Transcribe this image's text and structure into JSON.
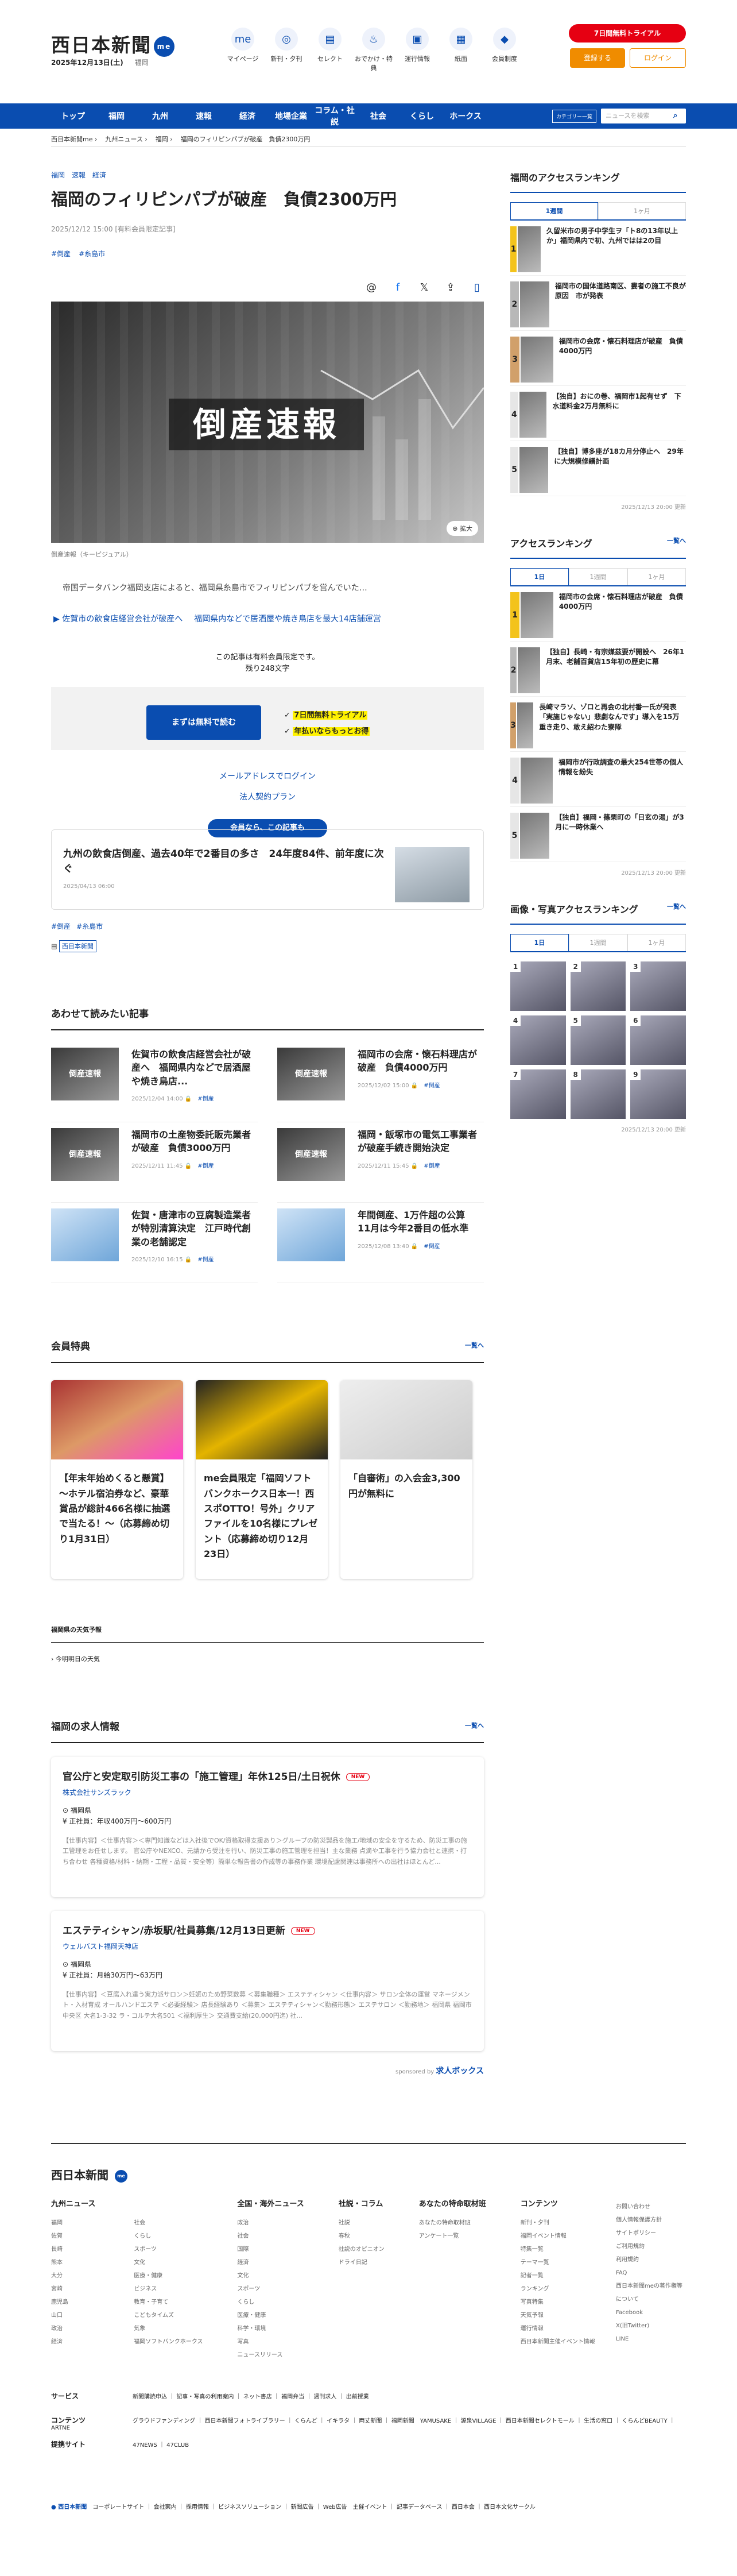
{
  "header": {
    "logo": "西日本新聞",
    "logo_badge": "me",
    "date": "2025年12月13日(土)",
    "region": "福岡",
    "icons": [
      {
        "label": "マイページ",
        "icon": "me"
      },
      {
        "label": "新刊・夕刊",
        "icon": "◎"
      },
      {
        "label": "セレクト",
        "icon": "▤"
      },
      {
        "label": "おでかけ・特典",
        "icon": "♨"
      },
      {
        "label": "運行情報",
        "icon": "▣"
      },
      {
        "label": "紙面",
        "icon": "▦"
      },
      {
        "label": "会員制度",
        "icon": "◆"
      }
    ],
    "trial": "7日間無料トライアル",
    "register": "登録する",
    "login": "ログイン"
  },
  "gnav": {
    "items": [
      "トップ",
      "福岡",
      "九州",
      "速報",
      "経済",
      "地場企業",
      "コラム・社説",
      "社会",
      "くらし",
      "ホークス"
    ],
    "category": "カテゴリー一覧",
    "search_placeholder": "ニュースを検索"
  },
  "breadcrumb": [
    "西日本新聞me",
    "九州ニュース",
    "福岡",
    "福岡のフィリピンパブが破産　負債2300万円"
  ],
  "article": {
    "tags": [
      "福岡",
      "速報",
      "経済"
    ],
    "title": "福岡のフィリピンパブが破産　負債2300万円",
    "published": "2025/12/12 15:00 [有料会員限定記事]",
    "hashtags": [
      "#倒産",
      "#糸島市"
    ],
    "hero_text": "倒産速報",
    "hero_caption": "倒産速報（キーピジュアル）",
    "hero_badge": "拡大",
    "lead": "帝国データバンク福岡支店によると、福岡県糸島市でフィリピンパブを営んでいた…",
    "related": [
      "佐賀市の飲食店経営会社が破産へ",
      "福岡県内などで居酒屋や焼き鳥店を最大14店舗運営"
    ],
    "paywall_text": "この記事は有料会員限定です。",
    "paywall_remaining": "残り248文字",
    "trial_button": "まずは無料で読む",
    "trial_points": [
      "7日間無料トライアル",
      "年払いならもっとお得"
    ],
    "email_login": "メールアドレスでログイン",
    "corporate": "法人契約プラン",
    "member_label": "会員なら、この記事も",
    "member_card": {
      "title": "九州の飲食店倒産、過去40年で2番目の多さ　24年度84件、前年度に次ぐ",
      "date": "2025/04/13 06:00"
    },
    "bottom_tags": [
      "#倒産",
      "#糸島市"
    ],
    "source": "西日本新聞"
  },
  "recommend": {
    "heading": "あわせて読みたい記事",
    "items": [
      {
        "title": "佐賀市の飲食店経営会社が破産へ　福岡県内などで居酒屋や焼き鳥店...",
        "date": "2025/12/04 14:00",
        "tag": "#倒産"
      },
      {
        "title": "福岡市の会席・懐石料理店が破産　負債4000万円",
        "date": "2025/12/02 15:00",
        "tag": "#倒産"
      },
      {
        "title": "福岡市の土産物委託販売業者が破産　負債3000万円",
        "date": "2025/12/11 11:45",
        "tag": "#倒産"
      },
      {
        "title": "福岡・飯塚市の電気工事業者が破産手続き開始決定",
        "date": "2025/12/11 15:45",
        "tag": "#倒産"
      },
      {
        "title": "佐賀・唐津市の豆腐製造業者が特別清算決定　江戸時代創業の老舗認定",
        "date": "2025/12/10 16:15",
        "tag": "#倒産"
      },
      {
        "title": "年間倒産、1万件超の公算　11月は今年2番目の低水準",
        "date": "2025/12/08 13:40",
        "tag": "#倒産"
      }
    ]
  },
  "benefits": {
    "heading": "会員特典",
    "more": "一覧へ",
    "items": [
      "【年末年始めくると懸賞】～ホテル宿泊券など、豪華賞品が総計466名様に抽選で当たる！～（応募締め切り1月31日）",
      "me会員限定「福岡ソフトバンクホークス日本一！西スポOTTO！号外」クリアファイルを10名様にプレゼント（応募締め切り12月23日）",
      "「自審術」の入会金3,300円が無料に"
    ]
  },
  "weather": {
    "heading": "福岡県の天気予報",
    "sub": "今明明日の天気"
  },
  "jobs": {
    "heading": "福岡の求人情報",
    "more": "一覧へ",
    "items": [
      {
        "title": "官公庁と安定取引防災工事の「施工管理」年休125日/土日祝休",
        "badge": "NEW",
        "company": "株式会社サンズラック",
        "location": "福岡県",
        "pay": "正社員：年収400万円〜600万円",
        "desc": "【仕事内容】＜仕事内容＞＜専門知識などは入社後でOK/資格取得支援あり＞グループの防災製品を施工/地域の安全を守るため、防災工事の施工管理をお任せします。 官公庁やNEXCO、元請から受注を行い、防災工事の施工管理を担当！主な業務 点滴や工事を行う協力会社と連携・打ち合わせ 各種資格/材料・納期・工程・品質・安全等）簡単な報告書の作成等の事務作業 環境配慮関連は事務所への出社はほとんど..."
      },
      {
        "title": "エステティシャン/赤坂駅/社員募集/12月13日更新",
        "badge": "NEW",
        "company": "ウェルバスト福岡天神店",
        "location": "福岡県",
        "pay": "正社員：月給30万円〜63万円",
        "desc": "【仕事内容】＜豆腐入れ達う実力派サロン＞妊娠のため野菜数募 ＜募集職種＞ エステティシャン ＜仕事内容＞ サロン全体の運営 マネージメント・入材育成 オールハンドエステ ＜必要経験＞ 店長経験あり ＜募集＞ エステティシャン＜勤務形態＞ エステサロン ＜勤務地＞ 福岡県 福岡市中央区 大名1-3-32 ラ・コルテ大名501 ＜福利厚生＞ 交通費支給(20,000円迄) 社..."
      }
    ],
    "sponsor": "sponsored by",
    "sponsor_name": "求人ボックス"
  },
  "sidebar": {
    "access": {
      "heading": "福岡のアクセスランキング",
      "tabs": [
        "1週間",
        "1ヶ月"
      ],
      "items": [
        "久留米市の男子中学生ヲ「ト8の13年以上か」福岡県内で初、九州ではは2の目",
        "福岡市の国体道路南区、婁者の施工不良が原因　市が発表",
        "福岡市の会席・懐石料理店が破産　負債4000万円",
        "【独自】おにの巻、福岡市1起有せず　下水道料金2万月無料に",
        "【独自】博多座が18カ月分停止へ　29年に大規模修繕計画"
      ],
      "updated": "2025/12/13 20:00 更新"
    },
    "all": {
      "heading": "アクセスランキング",
      "more": "一覧へ",
      "tabs": [
        "1日",
        "1週間",
        "1ヶ月"
      ],
      "items": [
        "福岡市の会席・懐石料理店が破産　負債4000万円",
        "【独自】長崎・有宗媒茲要が開設へ　26年1月末、老舗百貨店15年初の歴史に幕",
        "長崎マラソ、ゾロと再会の北村番一氏が発表「実施じゃない」悲劇なんです」導入を15万重き走り、敢え紹わた寮隊",
        "福岡市が行政調査の最大254世帯の個人情報を紛失",
        "【独自】福岡・篠栗町の「日玄の湯」が3月に一時休業へ"
      ],
      "updated": "2025/12/13 20:00 更新"
    },
    "photo": {
      "heading": "画像・写真アクセスランキング",
      "more": "一覧へ",
      "tabs": [
        "1日",
        "1週間",
        "1ヶ月"
      ],
      "updated": "2025/12/13 20:00 更新"
    }
  },
  "footer": {
    "logo": "西日本新聞",
    "cols": [
      {
        "h": "九州ニュース",
        "items": [
          "福岡",
          "佐賀",
          "長崎",
          "熊本",
          "大分",
          "宮崎",
          "鹿児島",
          "山口",
          "政治",
          "経済",
          "社会",
          "くらし",
          "スポーツ",
          "文化",
          "医療・健康",
          "ビジネス",
          "教育・子育て",
          "こどもタイムズ",
          "気象",
          "福岡ソフトバンクホークス"
        ]
      },
      {
        "h": "全国・海外ニュース",
        "items": [
          "政治",
          "社会",
          "国際",
          "経済",
          "文化",
          "スポーツ",
          "くらし",
          "医療・健康",
          "科学・環境",
          "写真",
          "ニュースリリース"
        ]
      },
      {
        "h": "社説・コラム",
        "items": [
          "社説",
          "春秋",
          "社説のオピニオン",
          "ドライ日記"
        ]
      },
      {
        "h": "あなたの特命取材班",
        "items": [
          "あなたの特命取材班",
          "アンケート一覧"
        ]
      },
      {
        "h": "コンテンツ",
        "items": [
          "新刊・夕刊",
          "福岡イベント情報",
          "特集一覧",
          "テーマ一覧",
          "記者一覧",
          "ランキング",
          "写真特集",
          "天気予報",
          "運行情報",
          "西日本新聞主催イベント情報"
        ]
      }
    ],
    "side": [
      "お問い合わせ",
      "個人情報保護方針",
      "サイトポリシー",
      "ご利用規約",
      "利用規約",
      "FAQ",
      "西日本新聞meの著作権等について",
      "Facebook",
      "X(旧Twitter)",
      "LINE"
    ],
    "rows": [
      {
        "h": "サービス",
        "items": "新聞購読申込 ｜ 記事・写真の利用案内 ｜ ネット書店 ｜ 福岡弁当 ｜ 週刊求人 ｜ 出前授業"
      },
      {
        "h": "コンテンツ",
        "items": "グラウドファンディング ｜ 西日本新聞フォトライブラリー ｜ くらんど ｜ イキラタ ｜ 両丈新聞 ｜ 福岡新聞　YAMUSAKE ｜ 源泉VILLAGE ｜ 西日本新聞セレクトモール ｜ 生活の窓口 ｜ くらんどBEAUTY ｜ ARTNE"
      },
      {
        "h": "提携サイト",
        "items": "47NEWS ｜ 47CLUB"
      }
    ],
    "copy": "コーポレートサイト ｜ 会社案内 ｜ 採用情報 ｜ ビジネスソリューション ｜ 新聞広告 ｜ Web広告　主催イベント ｜ 記事データベース ｜ 西日本会 ｜ 西日本文化サークル"
  }
}
